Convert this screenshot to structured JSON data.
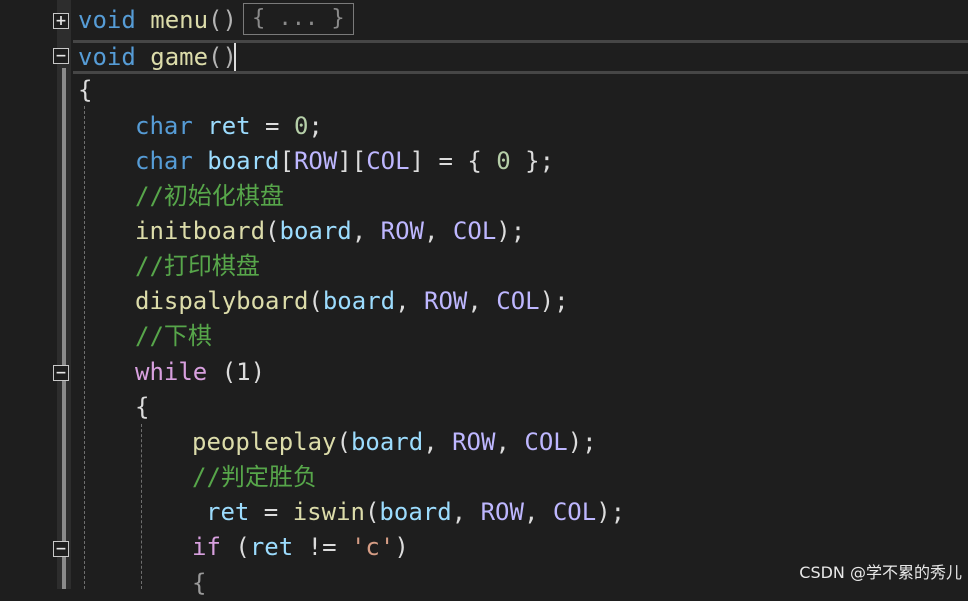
{
  "editor": {
    "fold_collapsed_glyph": "+",
    "fold_expanded_glyph": "−",
    "collapsed_placeholder": "{ ... }",
    "lines": {
      "l1_kw": "void",
      "l1_fn": "menu",
      "l1_paren": "()",
      "l2_kw": "void",
      "l2_fn": "game",
      "l2_paren": "()",
      "l3": "{",
      "l4_kw": "char",
      "l4_id": "ret",
      "l4_op": " = ",
      "l4_num": "0",
      "l4_end": ";",
      "l5_kw": "char",
      "l5_id": "board",
      "l5_b1": "[",
      "l5_m1": "ROW",
      "l5_b2": "][",
      "l5_m2": "COL",
      "l5_b3": "] = { ",
      "l5_num": "0",
      "l5_end": " };",
      "l6": "//初始化棋盘",
      "l7_fn": "initboard",
      "l7_p1": "(",
      "l7_a1": "board",
      "l7_c1": ", ",
      "l7_a2": "ROW",
      "l7_c2": ", ",
      "l7_a3": "COL",
      "l7_end": ");",
      "l8": "//打印棋盘",
      "l9_fn": "dispalyboard",
      "l9_p1": "(",
      "l9_a1": "board",
      "l9_c1": ", ",
      "l9_a2": "ROW",
      "l9_c2": ", ",
      "l9_a3": "COL",
      "l9_end": ");",
      "l10": "//下棋",
      "l11_kw": "while",
      "l11_rest": " (1)",
      "l12": "{",
      "l13_fn": "peopleplay",
      "l13_p1": "(",
      "l13_a1": "board",
      "l13_c1": ", ",
      "l13_a2": "ROW",
      "l13_c2": ", ",
      "l13_a3": "COL",
      "l13_end": ");",
      "l14": "//判定胜负",
      "l15_id": "ret",
      "l15_op": " = ",
      "l15_fn": "iswin",
      "l15_p1": "(",
      "l15_a1": "board",
      "l15_c1": ", ",
      "l15_a2": "ROW",
      "l15_c2": ", ",
      "l15_a3": "COL",
      "l15_end": ");",
      "l16_kw": "if",
      "l16_p1": " (",
      "l16_id": "ret",
      "l16_op": " != ",
      "l16_str": "'c'",
      "l16_end": ")",
      "l17": "{"
    }
  },
  "watermark": "CSDN @学不累的秀儿"
}
